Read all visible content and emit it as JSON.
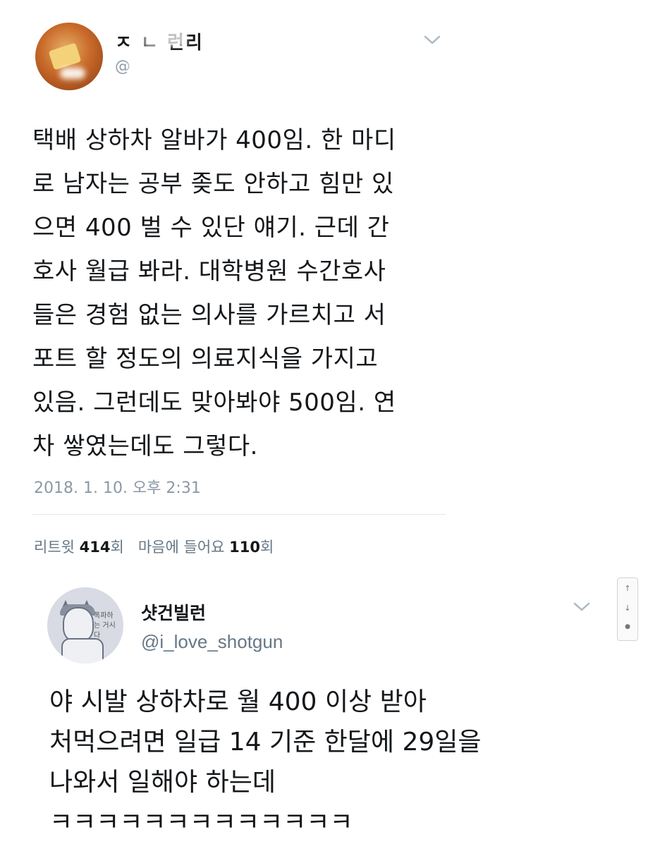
{
  "tweet1": {
    "display_name": "ㅈ ㄴ 런리",
    "handle": "@",
    "body_lines": [
      "택배 상하차 알바가 400임. 한 마디",
      "로 남자는 공부 좆도 안하고 힘만 있",
      "으면 400 벌 수 있단 얘기. 근데 간",
      "호사 월급 봐라. 대학병원 수간호사",
      "들은 경험 없는 의사를 가르치고 서",
      "포트 할 정도의 의료지식을 가지고",
      "있음. 그런데도 맞아봐야 500임. 연",
      "차 쌓였는데도 그렇다."
    ],
    "timestamp": "2018. 1. 10. 오후 2:31",
    "retweets_label": "리트윗",
    "retweets_count": "414",
    "retweets_unit": "회",
    "likes_label": "마음에 들어요",
    "likes_count": "110",
    "likes_unit": "회"
  },
  "side_controls": {
    "up": "↑",
    "down": "↓",
    "comment": "●"
  },
  "tweet2": {
    "display_name": "샷건빌런",
    "handle": "@i_love_shotgun",
    "avatar_text": "폭파하는 거시다",
    "body_lines": [
      "야 시발 상하차로 월 400 이상 받아",
      "처먹으려면 일급 14 기준 한달에 29일을",
      "나와서 일해야 하는데",
      "ㅋㅋㅋㅋㅋㅋㅋㅋㅋㅋㅋㅋㅋ"
    ]
  },
  "colors": {
    "text": "#14171a",
    "secondary": "#8b98a5",
    "divider": "#e1e8ed"
  }
}
